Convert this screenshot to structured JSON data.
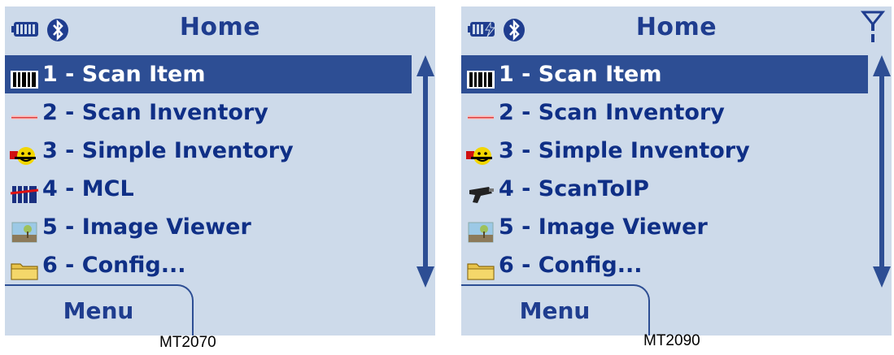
{
  "left": {
    "title": "Home",
    "items": [
      {
        "label": "1 - Scan Item",
        "icon": "barcode-icon",
        "selected": true
      },
      {
        "label": "2 - Scan Inventory",
        "icon": "scan-line-icon",
        "selected": false
      },
      {
        "label": "3 - Simple Inventory",
        "icon": "smiley-icon",
        "selected": false
      },
      {
        "label": "4 - MCL",
        "icon": "mcl-icon",
        "selected": false
      },
      {
        "label": "5 - Image Viewer",
        "icon": "image-icon",
        "selected": false
      },
      {
        "label": "6 - Config...",
        "icon": "folder-icon",
        "selected": false
      }
    ],
    "softkey": "Menu",
    "caption": "MT2070"
  },
  "right": {
    "title": "Home",
    "items": [
      {
        "label": "1 - Scan Item",
        "icon": "barcode-icon",
        "selected": true
      },
      {
        "label": "2 - Scan Inventory",
        "icon": "scan-line-icon",
        "selected": false
      },
      {
        "label": "3 - Simple Inventory",
        "icon": "smiley-icon",
        "selected": false
      },
      {
        "label": "4 - ScanToIP",
        "icon": "scanner-gun-icon",
        "selected": false
      },
      {
        "label": "5 - Image Viewer",
        "icon": "image-icon",
        "selected": false
      },
      {
        "label": "6 - Config...",
        "icon": "folder-icon",
        "selected": false
      }
    ],
    "softkey": "Menu",
    "caption": "MT2090"
  },
  "colors": {
    "background": "#cddaea",
    "selected": "#2d4e94",
    "text": "#0f2f86"
  }
}
